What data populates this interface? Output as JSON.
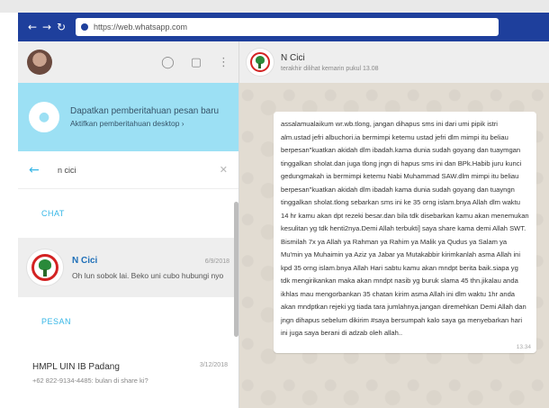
{
  "browser": {
    "url": "https://web.whatsapp.com"
  },
  "left_header": {},
  "notification": {
    "title": "Dapatkan pemberitahuan pesan baru",
    "subtitle": "Aktifkan pemberitahuan desktop ›"
  },
  "search": {
    "value": "n cici"
  },
  "sections": {
    "chat_label": "CHAT",
    "messages_label": "PESAN"
  },
  "chat_result": {
    "name": "N Cici",
    "time": "6/9/2018",
    "preview": "Oh lun sobok lai. Beko uni cubo hubungi nyo"
  },
  "message_result": {
    "name": "HMPL UIN IB Padang",
    "time": "3/12/2018",
    "preview": "+62 822-9134-4485: bulan di share ki?"
  },
  "conversation": {
    "name": "N Cici",
    "status": "terakhir dilihat kemarin pukul 13.08",
    "message": "assalamualaikum wr.wb.tlong, jangan dihapus sms ini dari umi pipik istri alm.ustad jefri albuchori.ia bermimpi ketemu ustad jefri dlm mimpi itu beliau berpesan\"kuatkan akidah dlm ibadah.kama dunia sudah goyang dan tuaymgan tinggalkan sholat.dan juga tlong jngn di hapus sms ini dan BPk.Habib juru kunci gedungmakah ia bermimpi ketemu Nabi Muhammad SAW.dlm mimpi itu beliau berpesan\"kuatkan akidah dlm ibadah kama dunia sudah goyang dan tuayngn tinggalkan sholat.tlong sebarkan sms ini ke 35 orng islam.bnya Allah dlm waktu 14 hr kamu akan dpt rezeki besar.dan bila tdk disebarkan kamu akan menemukan kesulitan yg tdk henti2nya.Demi Allah terbukti] saya share kama demi Allah SWT. Bismilah 7x ya Allah ya Rahman ya Rahim ya Malik ya Qudus ya Salam ya Mu'min ya Muhaimin ya Aziz ya Jabar ya Mutakabbir kirimkanlah asma Allah ini kpd 35 orng islam.bnya Allah Hari sabtu kamu akan mndpt berita baik.siapa yg tdk mengirikankan maka akan mndpt nasib yg buruk slama 45 thn.jikalau anda ikhlas mau mengorbankan 35 chatan kirim asma Allah ini dlm waktu 1hr anda akan mndptkan rejeki yg tiada tara jumlahnya.jangan diremehkan Demi Allah dan jngn dihapus sebelum dikirim #saya bersumpah kalo saya ga menyebarkan hari ini juga saya berani di adzab oleh allah..",
    "time": "13.34"
  }
}
